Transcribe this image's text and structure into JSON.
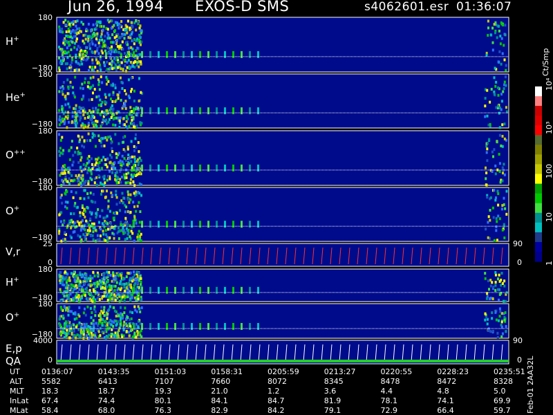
{
  "header": {
    "date": "Jun 26, 1994",
    "instrument": "EXOS-D SMS",
    "file": "s4062601.esr",
    "time": "01:36:07"
  },
  "colorbar": {
    "unit": "Ct/Smp",
    "ticks": [
      "10⁴",
      "10³",
      "100",
      "10",
      "1"
    ],
    "colors": [
      "#ffffff",
      "#ff8080",
      "#cc0000",
      "#e00000",
      "#ff0000",
      "#556b2f",
      "#808000",
      "#a0a000",
      "#c8c800",
      "#ffff00",
      "#00a000",
      "#00c800",
      "#40e040",
      "#009090",
      "#00c0c0",
      "#1e3a8a",
      "#0000a0",
      "#00008b"
    ]
  },
  "panels": [
    {
      "id": "h-plus",
      "species": "H",
      "charge": "+",
      "top_tick": "180",
      "bottom_tick": "−180"
    },
    {
      "id": "he-plus",
      "species": "He",
      "charge": "+",
      "top_tick": "180",
      "bottom_tick": "−180"
    },
    {
      "id": "o-plusplus",
      "species": "O",
      "charge": "++",
      "top_tick": "180",
      "bottom_tick": "−180"
    },
    {
      "id": "o-plus",
      "species": "O",
      "charge": "+",
      "top_tick": "180",
      "bottom_tick": "−180"
    },
    {
      "id": "vr",
      "species": "V,r",
      "charge": "",
      "top_tick": "25",
      "bottom_tick": "0",
      "right_top": "90",
      "right_bottom": "0"
    },
    {
      "id": "h-plus-2",
      "species": "H",
      "charge": "+",
      "top_tick": "180",
      "bottom_tick": "−180"
    },
    {
      "id": "o-plus-2",
      "species": "O",
      "charge": "+",
      "top_tick": "180",
      "bottom_tick": "−180"
    },
    {
      "id": "ep-qa",
      "species": "E,p",
      "species2": "QA",
      "charge": "",
      "top_tick": "4000",
      "bottom_tick": "0",
      "right_top": "90",
      "right_bottom": "0"
    }
  ],
  "footer": {
    "rows": [
      {
        "label": "UT",
        "values": [
          "0136:07",
          "0143:35",
          "0151:03",
          "0158:31",
          "0205:59",
          "0213:27",
          "0220:55",
          "0228:23",
          "0235:51"
        ]
      },
      {
        "label": "ALT",
        "values": [
          "5582",
          "6413",
          "7107",
          "7660",
          "8072",
          "8345",
          "8478",
          "8472",
          "8328"
        ]
      },
      {
        "label": "MLT",
        "values": [
          "18.3",
          "18.7",
          "19.3",
          "21.0",
          "1.2",
          "3.6",
          "4.4",
          "4.8",
          "5.0"
        ]
      },
      {
        "label": "InLat",
        "values": [
          "67.4",
          "74.4",
          "80.1",
          "84.1",
          "84.7",
          "81.9",
          "78.1",
          "74.1",
          "69.9"
        ]
      },
      {
        "label": "MLat",
        "values": [
          "58.4",
          "68.0",
          "76.3",
          "82.9",
          "84.2",
          "79.1",
          "72.9",
          "66.4",
          "59.7"
        ]
      }
    ],
    "side_label": "Feb-01 2AA32L"
  },
  "chart_data": {
    "type": "heatmap",
    "title": "Jun 26, 1994   EXOS-D SMS",
    "x": [
      "0136:07",
      "0143:35",
      "0151:03",
      "0158:31",
      "0205:59",
      "0213:27",
      "0220:55",
      "0228:23",
      "0235:51"
    ],
    "y_range_pitch": [
      -180,
      180
    ],
    "color_scale": "log",
    "color_range": [
      1,
      10000
    ],
    "color_unit": "Ct/Smp"
  }
}
